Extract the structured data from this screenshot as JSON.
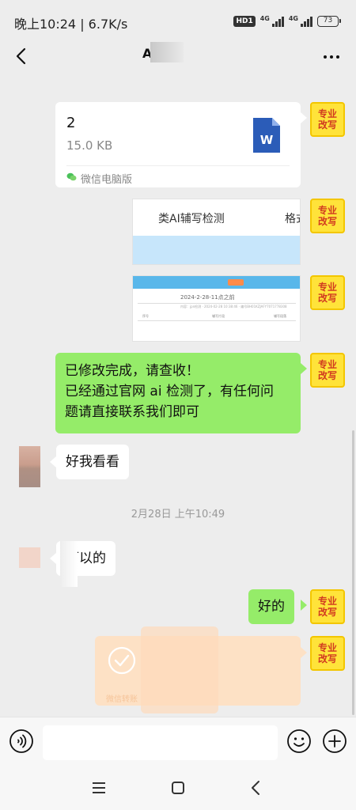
{
  "status_bar": {
    "time": "晚上10:24 | 6.7K/s",
    "hd": "HD1",
    "net1": "4G",
    "net2": "4G",
    "battery": "73"
  },
  "header": {
    "title": "A"
  },
  "self_avatar": {
    "text": "专业\n改写"
  },
  "messages": {
    "file": {
      "name": "2",
      "size": "15.0 KB",
      "source": "微信电脑版",
      "icon": "word-icon"
    },
    "image1": {
      "label_a": "类AI辅写检测",
      "label_b": "格式"
    },
    "image2": {
      "date": "2024-2-28-11点之前",
      "subtext": "内容：jpn检测 · 2024-02-28 10:38:46 · 编号BH01KZJAFY7071778308",
      "col1": "序号",
      "col2": "辅写片段",
      "col3": "辅写段落"
    },
    "green1": {
      "lines": [
        "已修改完成，请查收！",
        "已经通过官网 ai 检测了，有任何问",
        "题请直接联系我们即可"
      ]
    },
    "reply1": "好我看看",
    "timestamp": "2月28日 上午10:49",
    "reply2": "可以的",
    "green2": "好的",
    "transfer": {
      "label": "微信转账"
    }
  },
  "input_bar": {
    "placeholder": ""
  },
  "colors": {
    "self_bubble": "#95ec69",
    "other_bubble": "#ffffff",
    "background": "#ededed",
    "transfer": "#fde1c5",
    "avatar_badge": "#ffe33a"
  }
}
